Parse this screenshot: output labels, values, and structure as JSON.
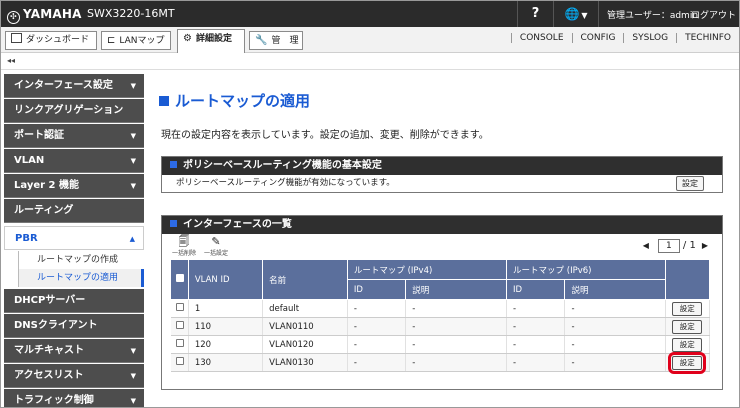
{
  "header": {
    "brand": "YAMAHA",
    "model": "SWX3220-16MT",
    "help_label": "?",
    "lang_icon": "globe-icon",
    "user_label": "管理ユーザー：admin",
    "logout_label": "ログアウト"
  },
  "menubar": {
    "tabs": [
      {
        "label": "ダッシュボード"
      },
      {
        "label": "LANマップ"
      },
      {
        "label": "詳細設定"
      },
      {
        "label": "管　理"
      }
    ],
    "links": [
      "CONSOLE",
      "CONFIG",
      "SYSLOG",
      "TECHINFO"
    ]
  },
  "collapse_label": "◂◂",
  "sidebar": {
    "items": [
      {
        "label": "インターフェース設定",
        "arrow": "▼"
      },
      {
        "label": "リンクアグリゲーション",
        "arrow": ""
      },
      {
        "label": "ポート認証",
        "arrow": "▼"
      },
      {
        "label": "VLAN",
        "arrow": "▼"
      },
      {
        "label": "Layer 2 機能",
        "arrow": "▼"
      },
      {
        "label": "ルーティング",
        "arrow": ""
      },
      {
        "label": "PBR",
        "arrow": "▲"
      },
      {
        "label": "DHCPサーバー",
        "arrow": ""
      },
      {
        "label": "DNSクライアント",
        "arrow": ""
      },
      {
        "label": "マルチキャスト",
        "arrow": "▼"
      },
      {
        "label": "アクセスリスト",
        "arrow": "▼"
      },
      {
        "label": "トラフィック制御",
        "arrow": "▼"
      }
    ],
    "sub_items": [
      {
        "label": "ルートマップの作成"
      },
      {
        "label": "ルートマップの適用"
      }
    ]
  },
  "main": {
    "title": "ルートマップの適用",
    "description": "現在の設定内容を表示しています。設定の追加、変更、削除ができます。",
    "basic": {
      "title": "ポリシーベースルーティング機能の基本設定",
      "status": "ポリシーベースルーティング機能が有効になっています。",
      "button": "設定"
    },
    "iflist": {
      "title": "インターフェースの一覧",
      "tools": [
        {
          "icon": "delete-all-icon",
          "label": "一括削除"
        },
        {
          "icon": "edit-all-icon",
          "label": "一括設定"
        }
      ],
      "pager": {
        "current": "1",
        "total": "/ 1",
        "prev": "◀",
        "next": "▶"
      },
      "columns": {
        "vlan_id": "VLAN ID",
        "name": "名前",
        "rm_ipv4": "ルートマップ (IPv4)",
        "rm_ipv6": "ルートマップ (IPv6)",
        "id": "ID",
        "desc": "説明"
      },
      "rows": [
        {
          "vlan": "1",
          "name": "default",
          "v4id": "-",
          "v4desc": "-",
          "v6id": "-",
          "v6desc": "-",
          "button": "設定"
        },
        {
          "vlan": "110",
          "name": "VLAN0110",
          "v4id": "-",
          "v4desc": "-",
          "v6id": "-",
          "v6desc": "-",
          "button": "設定"
        },
        {
          "vlan": "120",
          "name": "VLAN0120",
          "v4id": "-",
          "v4desc": "-",
          "v6id": "-",
          "v6desc": "-",
          "button": "設定"
        },
        {
          "vlan": "130",
          "name": "VLAN0130",
          "v4id": "-",
          "v4desc": "-",
          "v6id": "-",
          "v6desc": "-",
          "button": "設定"
        }
      ]
    }
  },
  "colors": {
    "accent": "#1a5bd3",
    "table_header": "#5b6f9c",
    "highlight": "#e0001b"
  }
}
